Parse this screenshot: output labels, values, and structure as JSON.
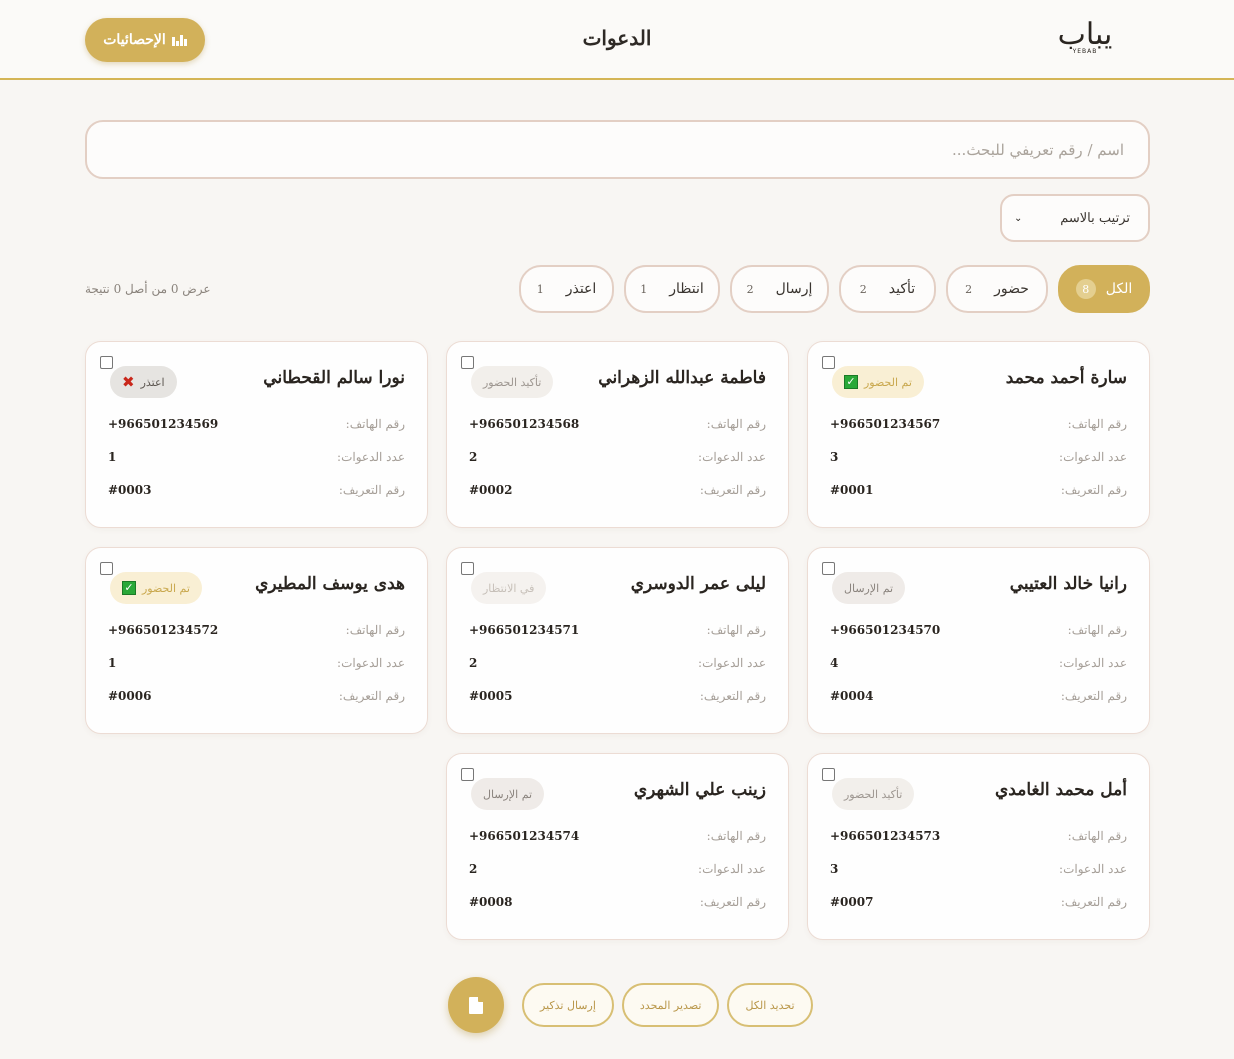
{
  "header": {
    "logo_ar": "يباب",
    "logo_en": "YEBAB",
    "title": "الدعوات",
    "stats_button": "الإحصائيات",
    "stats_icon": "bar-chart-icon"
  },
  "search": {
    "placeholder": "اسم / رقم تعريفي للبحث..."
  },
  "sort": {
    "selected": "ترتيب بالاسم"
  },
  "filters": [
    {
      "label": "الكل",
      "count": "8",
      "active": true
    },
    {
      "label": "حضور",
      "count": "2"
    },
    {
      "label": "تأكيد",
      "count": "2"
    },
    {
      "label": "إرسال",
      "count": "2"
    },
    {
      "label": "انتظار",
      "count": "1"
    },
    {
      "label": "اعتذر",
      "count": "1"
    }
  ],
  "result_count": "عرض 0 من أصل 0 نتيجة",
  "labels": {
    "phone": "رقم الهاتف:",
    "invites": "عدد الدعوات:",
    "id": "رقم التعريف:"
  },
  "guests": [
    {
      "name": "سارة أحمد محمد",
      "status": "تم الحضور",
      "status_type": "attended",
      "phone": "+966501234567",
      "invites": "3",
      "id": "#0001"
    },
    {
      "name": "فاطمة عبدالله الزهراني",
      "status": "تأكيد الحضور",
      "status_type": "confirm",
      "phone": "+966501234568",
      "invites": "2",
      "id": "#0002"
    },
    {
      "name": "نورا سالم القحطاني",
      "status": "اعتذر",
      "status_type": "declined",
      "phone": "+966501234569",
      "invites": "1",
      "id": "#0003"
    },
    {
      "name": "رانيا خالد العتيبي",
      "status": "تم الإرسال",
      "status_type": "sent",
      "phone": "+966501234570",
      "invites": "4",
      "id": "#0004"
    },
    {
      "name": "ليلى عمر الدوسري",
      "status": "في الانتظار",
      "status_type": "pending",
      "phone": "+966501234571",
      "invites": "2",
      "id": "#0005"
    },
    {
      "name": "هدى يوسف المطيري",
      "status": "تم الحضور",
      "status_type": "attended",
      "phone": "+966501234572",
      "invites": "1",
      "id": "#0006"
    },
    {
      "name": "أمل محمد الغامدي",
      "status": "تأكيد الحضور",
      "status_type": "confirm",
      "phone": "+966501234573",
      "invites": "3",
      "id": "#0007"
    },
    {
      "name": "زينب علي الشهري",
      "status": "تم الإرسال",
      "status_type": "sent",
      "phone": "+966501234574",
      "invites": "2",
      "id": "#0008"
    }
  ],
  "actions": {
    "select_all": "تحديد الكل",
    "export_selected": "تصدير المحدد",
    "send_reminder": "إرسال تذكير",
    "fab_icon": "document-icon"
  },
  "colors": {
    "accent": "#d2b15a",
    "border": "#e3cfc4",
    "background": "#f8f6f3"
  }
}
